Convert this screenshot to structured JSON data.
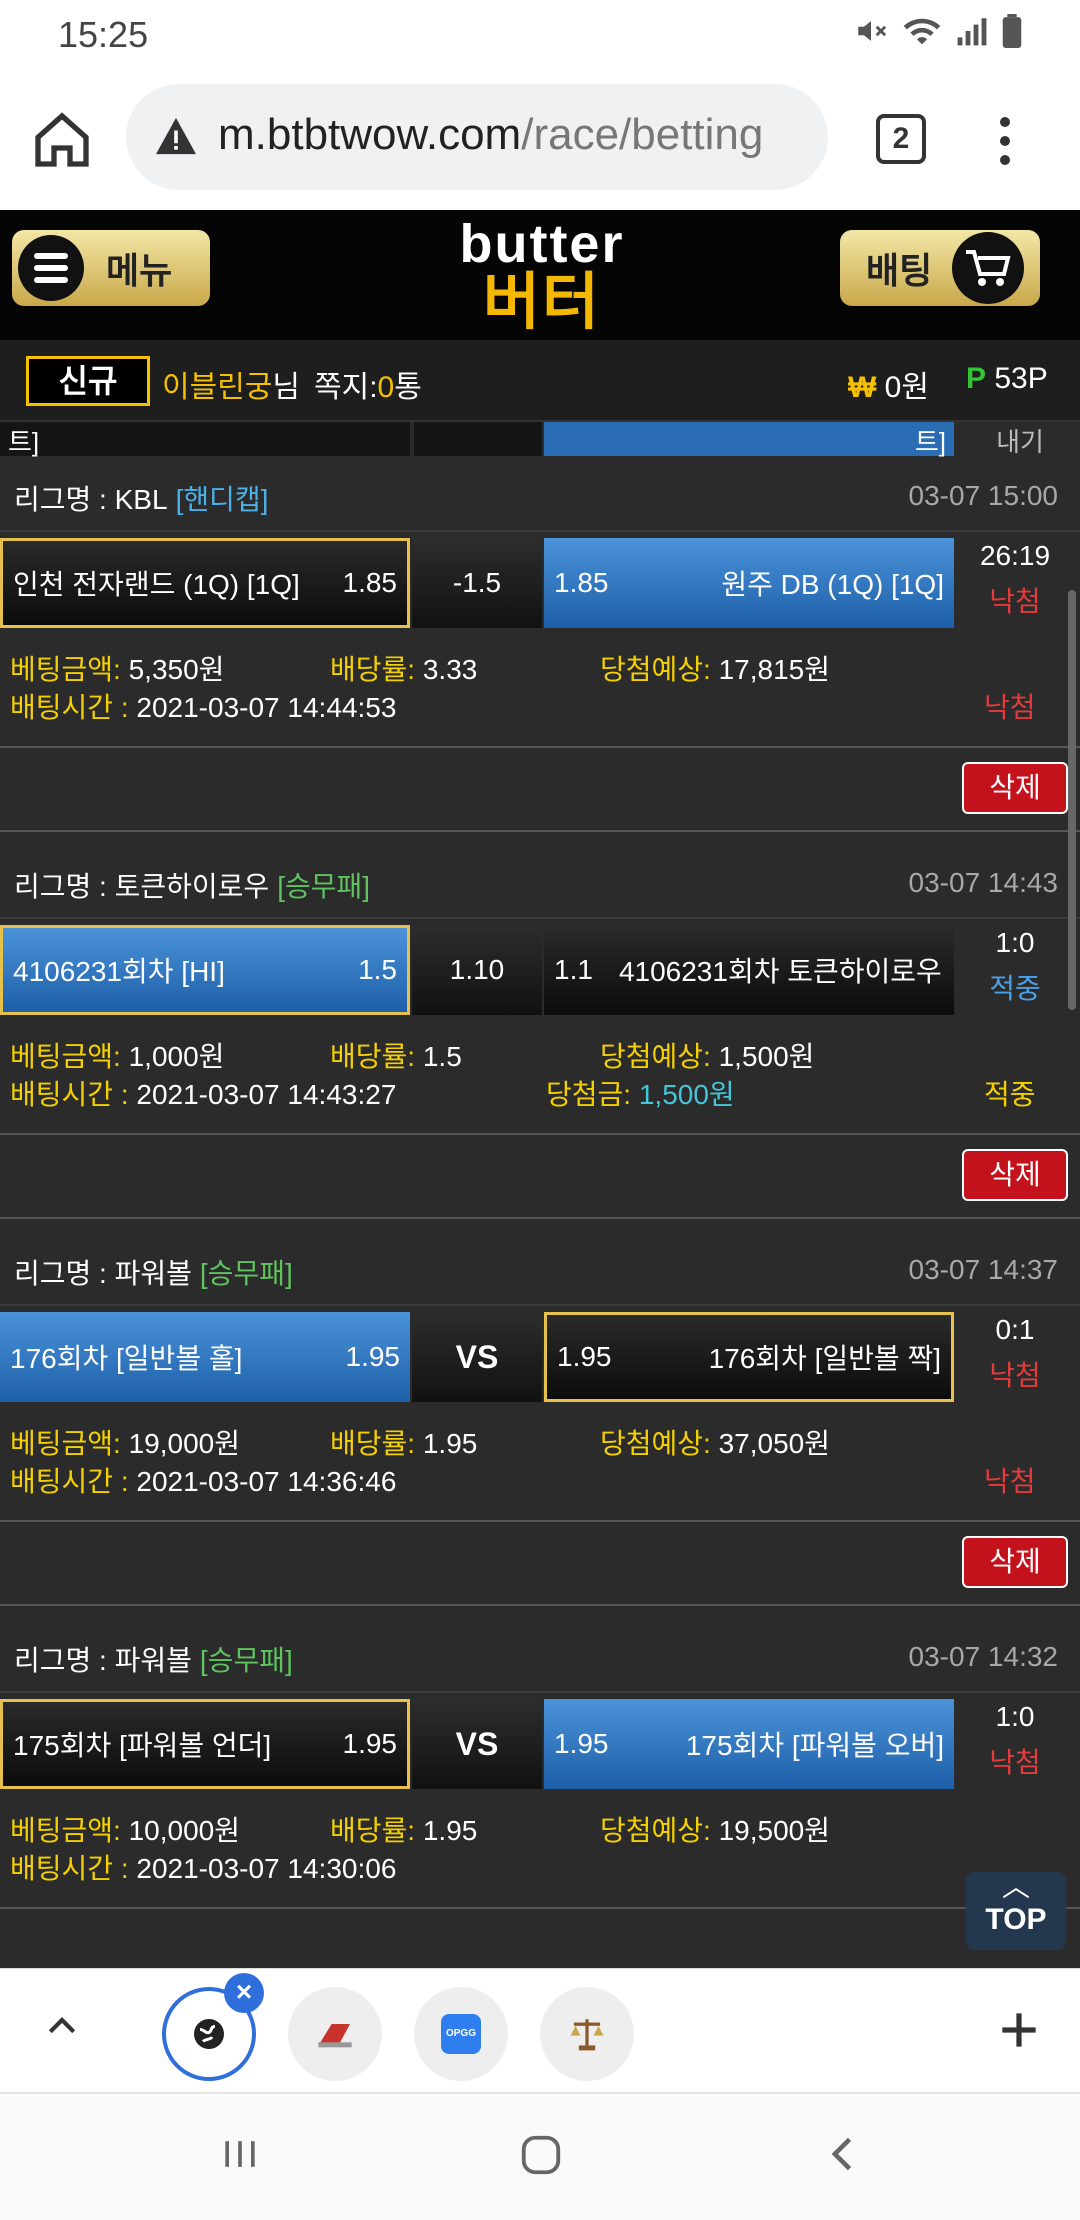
{
  "status": {
    "time": "15:25"
  },
  "browser": {
    "url_host": "m.btbtwow.com",
    "url_path": "/race/betting",
    "tab_count": "2"
  },
  "header": {
    "menu_label": "메뉴",
    "bet_label": "배팅",
    "logo_en": "butter",
    "logo_ko": "버터"
  },
  "user": {
    "badge": "신규",
    "name": "이블린궁",
    "name_suffix": "님",
    "memo_label": "쪽지:",
    "memo_count": "0",
    "memo_unit": "통",
    "money_symbol": "₩",
    "money": "0원",
    "points_symbol": "P",
    "points": "53P"
  },
  "partial_row": {
    "left": "트]",
    "right": "트]",
    "result": "내기"
  },
  "labels": {
    "league": "리그명 : ",
    "bet_amount": "베팅금액:",
    "odds": "배당률:",
    "expected": "당첨예상:",
    "bet_time": "배팅시간 : ",
    "win_amount": "당첨금:",
    "delete": "삭제"
  },
  "bets": [
    {
      "league": "KBL",
      "type": "[핸디캡]",
      "time": "03-07 15:00",
      "home": "인천 전자랜드 (1Q) [1Q]",
      "home_odds": "1.85",
      "handicap": "-1.5",
      "away_odds": "1.85",
      "away": "원주 DB (1Q) [1Q]",
      "score": "26:19",
      "status": "낙첨",
      "amount": "5,350원",
      "odds": "3.33",
      "expected": "17,815원",
      "bet_time": "2021-03-07 14:44:53",
      "result": "낙첨"
    },
    {
      "league": "토큰하이로우",
      "type": "[승무패]",
      "time": "03-07 14:43",
      "home": "4106231회차 [HI]",
      "home_odds": "1.5",
      "handicap": "1.10",
      "away_odds": "1.1",
      "away": "4106231회차 토큰하이로우",
      "score": "1:0",
      "status": "적중",
      "amount": "1,000원",
      "odds": "1.5",
      "expected": "1,500원",
      "bet_time": "2021-03-07 14:43:27",
      "win_amount": "1,500원",
      "result": "적중"
    },
    {
      "league": "파워볼",
      "type": "[승무패]",
      "time": "03-07 14:37",
      "home": "176회차 [일반볼 홀]",
      "home_odds": "1.95",
      "handicap": "VS",
      "away_odds": "1.95",
      "away": "176회차 [일반볼 짝]",
      "score": "0:1",
      "status": "낙첨",
      "amount": "19,000원",
      "odds": "1.95",
      "expected": "37,050원",
      "bet_time": "2021-03-07 14:36:46",
      "result": "낙첨"
    },
    {
      "league": "파워볼",
      "type": "[승무패]",
      "time": "03-07 14:32",
      "home": "175회차 [파워볼 언더]",
      "home_odds": "1.95",
      "handicap": "VS",
      "away_odds": "1.95",
      "away": "175회차 [파워볼 오버]",
      "score": "1:0",
      "status": "낙첨",
      "amount": "10,000원",
      "odds": "1.95",
      "expected": "19,500원",
      "bet_time": "2021-03-07 14:30:06"
    }
  ],
  "top_button": "TOP",
  "tab_icons": [
    "globe-icon",
    "red-app-icon",
    "opgg-icon",
    "scale-icon"
  ],
  "opgg": "OPGG"
}
